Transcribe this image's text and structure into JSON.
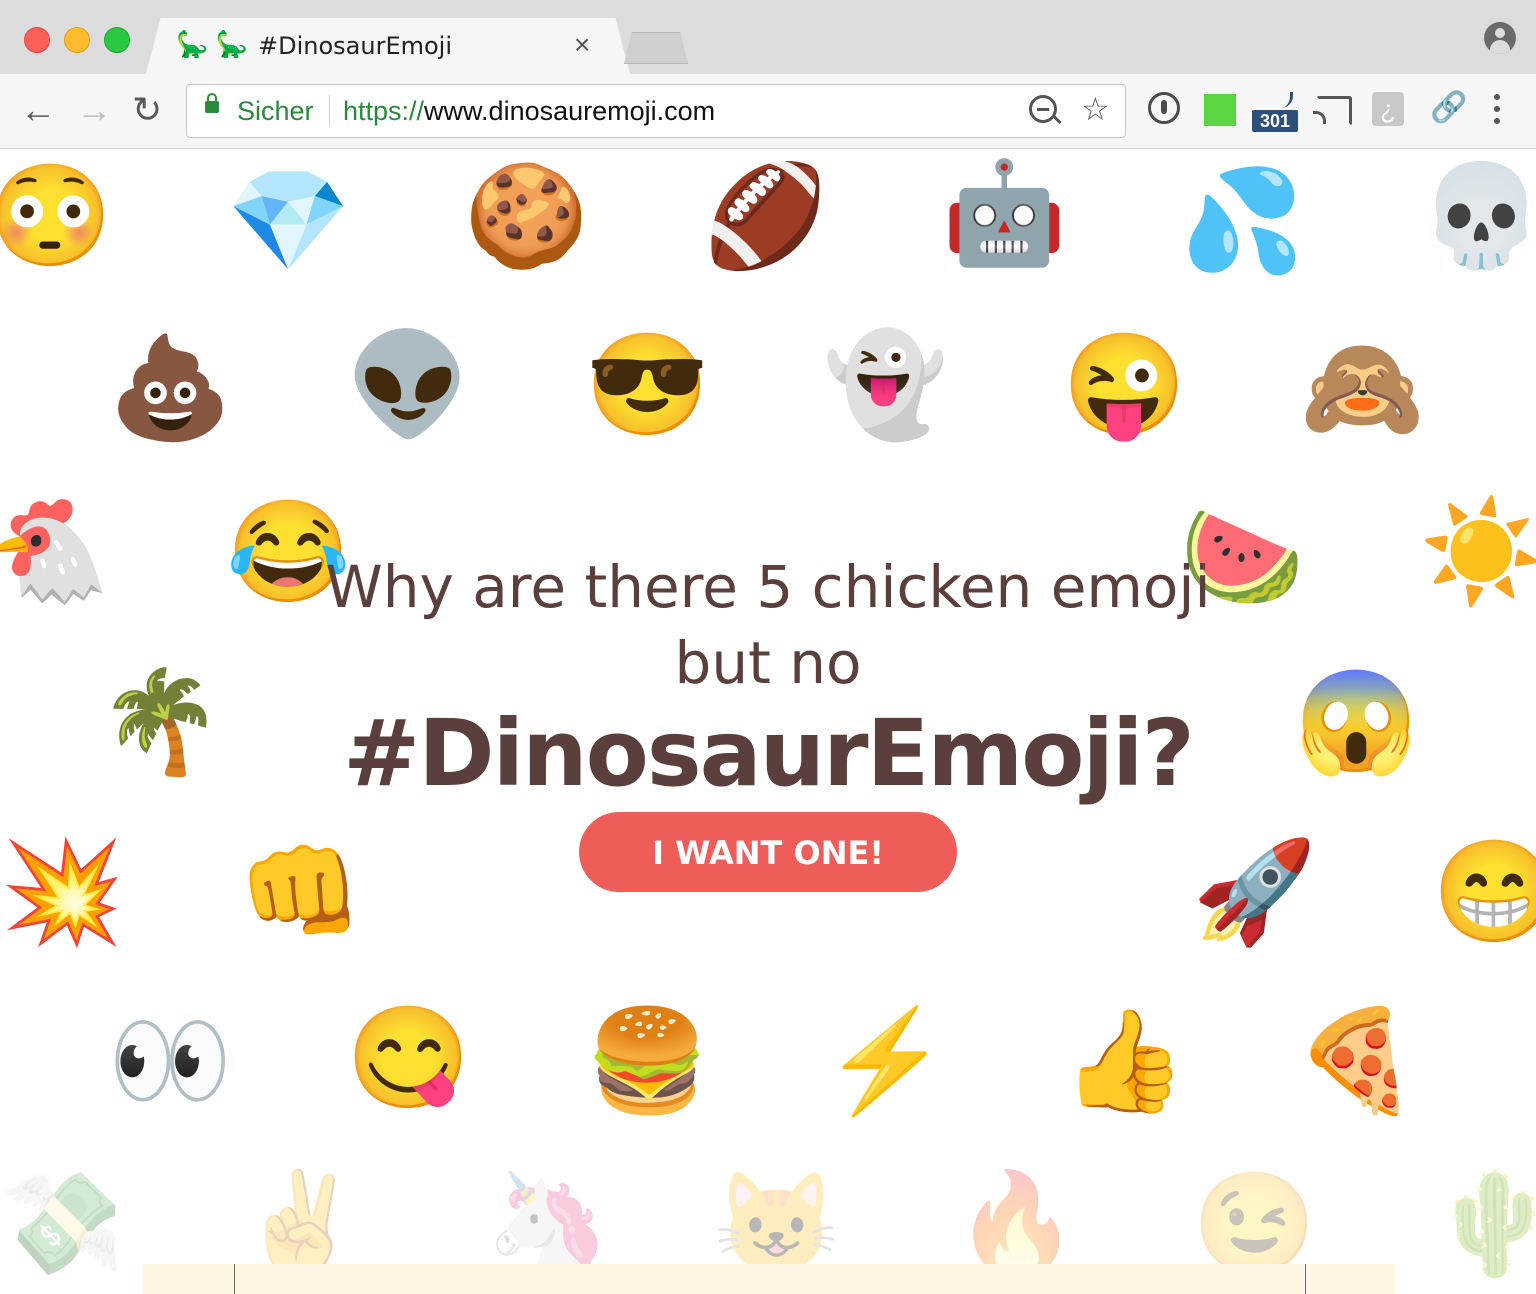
{
  "window": {
    "tab": {
      "favicon": "🦕 🦕",
      "title": "#DinosaurEmoji",
      "close_glyph": "×"
    }
  },
  "toolbar": {
    "back_glyph": "←",
    "forward_glyph": "→",
    "reload_glyph": "↻",
    "security_label": "Sicher",
    "url_scheme": "https://",
    "url_host": "www.dinosauremoji.com",
    "star_glyph": "☆",
    "extensions": [
      {
        "name": "password-manager-icon"
      },
      {
        "name": "green-square-extension-icon",
        "color": "#59d640"
      },
      {
        "name": "redirect-path-icon",
        "badge": "301"
      },
      {
        "name": "cast-icon"
      },
      {
        "name": "hook-extension-icon",
        "glyph": "¿"
      },
      {
        "name": "link-extension-icon",
        "glyph": "🔗"
      }
    ]
  },
  "hero": {
    "question_line1": "Why are there 5 chicken emoji",
    "question_line2": "but no",
    "hashtag": "#DinosaurEmoji?",
    "cta_label": "I WANT ONE!"
  },
  "colors": {
    "headline": "#5a3f3c",
    "cta_background": "#ef5d59",
    "secure_green": "#2a8a3c",
    "footer_strip": "#fdf6e2"
  },
  "emojis": [
    {
      "glyph": "😳",
      "name": "flushed-face-emoji"
    },
    {
      "glyph": "💎",
      "name": "gem-emoji"
    },
    {
      "glyph": "🍪",
      "name": "cookie-emoji"
    },
    {
      "glyph": "🏈",
      "name": "football-emoji"
    },
    {
      "glyph": "🤖",
      "name": "robot-emoji"
    },
    {
      "glyph": "💦",
      "name": "sweat-droplets-emoji"
    },
    {
      "glyph": "💀",
      "name": "skull-emoji"
    },
    {
      "glyph": "💩",
      "name": "poop-emoji"
    },
    {
      "glyph": "👽",
      "name": "alien-emoji"
    },
    {
      "glyph": "😎",
      "name": "sunglasses-face-emoji"
    },
    {
      "glyph": "👻",
      "name": "ghost-emoji"
    },
    {
      "glyph": "😜",
      "name": "winking-tongue-face-emoji"
    },
    {
      "glyph": "🙈",
      "name": "see-no-evil-monkey-emoji"
    },
    {
      "glyph": "🐔",
      "name": "chicken-emoji"
    },
    {
      "glyph": "😂",
      "name": "tears-of-joy-emoji"
    },
    {
      "glyph": "🍉",
      "name": "watermelon-emoji"
    },
    {
      "glyph": "☀️",
      "name": "sun-emoji"
    },
    {
      "glyph": "🌴",
      "name": "palm-tree-emoji"
    },
    {
      "glyph": "😱",
      "name": "screaming-face-emoji"
    },
    {
      "glyph": "💥",
      "name": "collision-emoji"
    },
    {
      "glyph": "👊",
      "name": "fist-emoji"
    },
    {
      "glyph": "🚀",
      "name": "rocket-emoji"
    },
    {
      "glyph": "😁",
      "name": "grinning-face-emoji"
    },
    {
      "glyph": "👀",
      "name": "eyes-emoji"
    },
    {
      "glyph": "😋",
      "name": "yum-face-emoji"
    },
    {
      "glyph": "🍔",
      "name": "hamburger-emoji"
    },
    {
      "glyph": "⚡",
      "name": "lightning-emoji"
    },
    {
      "glyph": "👍",
      "name": "thumbs-up-emoji"
    },
    {
      "glyph": "🍕",
      "name": "pizza-emoji"
    },
    {
      "glyph": "💸",
      "name": "money-wings-emoji"
    },
    {
      "glyph": "✌️",
      "name": "victory-hand-emoji"
    },
    {
      "glyph": "🦄",
      "name": "unicorn-emoji"
    },
    {
      "glyph": "😺",
      "name": "cat-face-emoji"
    },
    {
      "glyph": "🔥",
      "name": "fire-emoji"
    },
    {
      "glyph": "😉",
      "name": "winking-face-emoji"
    },
    {
      "glyph": "🌵",
      "name": "cactus-emoji"
    }
  ]
}
